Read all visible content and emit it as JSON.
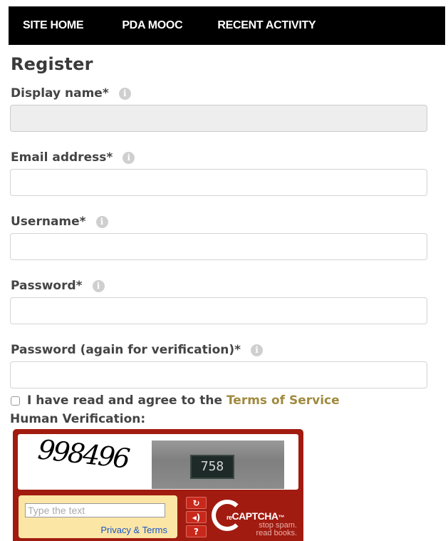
{
  "nav": {
    "items": [
      {
        "label": "SITE HOME"
      },
      {
        "label": "PDA MOOC"
      },
      {
        "label": "RECENT ACTIVITY"
      }
    ]
  },
  "form": {
    "title": "Register",
    "fields": [
      {
        "label": "Display name*",
        "value": "",
        "disabled": true
      },
      {
        "label": "Email address*",
        "value": ""
      },
      {
        "label": "Username*",
        "value": ""
      },
      {
        "label": "Password*",
        "value": ""
      },
      {
        "label": "Password (again for verification)*",
        "value": ""
      }
    ],
    "info_icon_glyph": "i",
    "tos": {
      "checked": false,
      "text": "I have read and agree to the",
      "link": "Terms of Service"
    },
    "human_verification_label": "Human Verification:"
  },
  "recaptcha": {
    "challenge_word": "998496",
    "challenge_photo_number": "758",
    "response_placeholder": "Type the text",
    "privacy_link": "Privacy & Terms",
    "buttons": [
      {
        "icon": "reload-icon",
        "glyph": "↻"
      },
      {
        "icon": "audio-icon",
        "glyph": "◂)"
      },
      {
        "icon": "help-icon",
        "glyph": "?"
      }
    ],
    "logo_re": "re",
    "logo_captcha": "CAPTCHA",
    "logo_tm": "™",
    "tagline_line1": "stop spam.",
    "tagline_line2": "read books."
  },
  "colors": {
    "navbar_bg": "#000000",
    "recaptcha_red": "#a11b10",
    "tos_link": "#a08a3e",
    "privacy_link": "#1a56c6"
  }
}
